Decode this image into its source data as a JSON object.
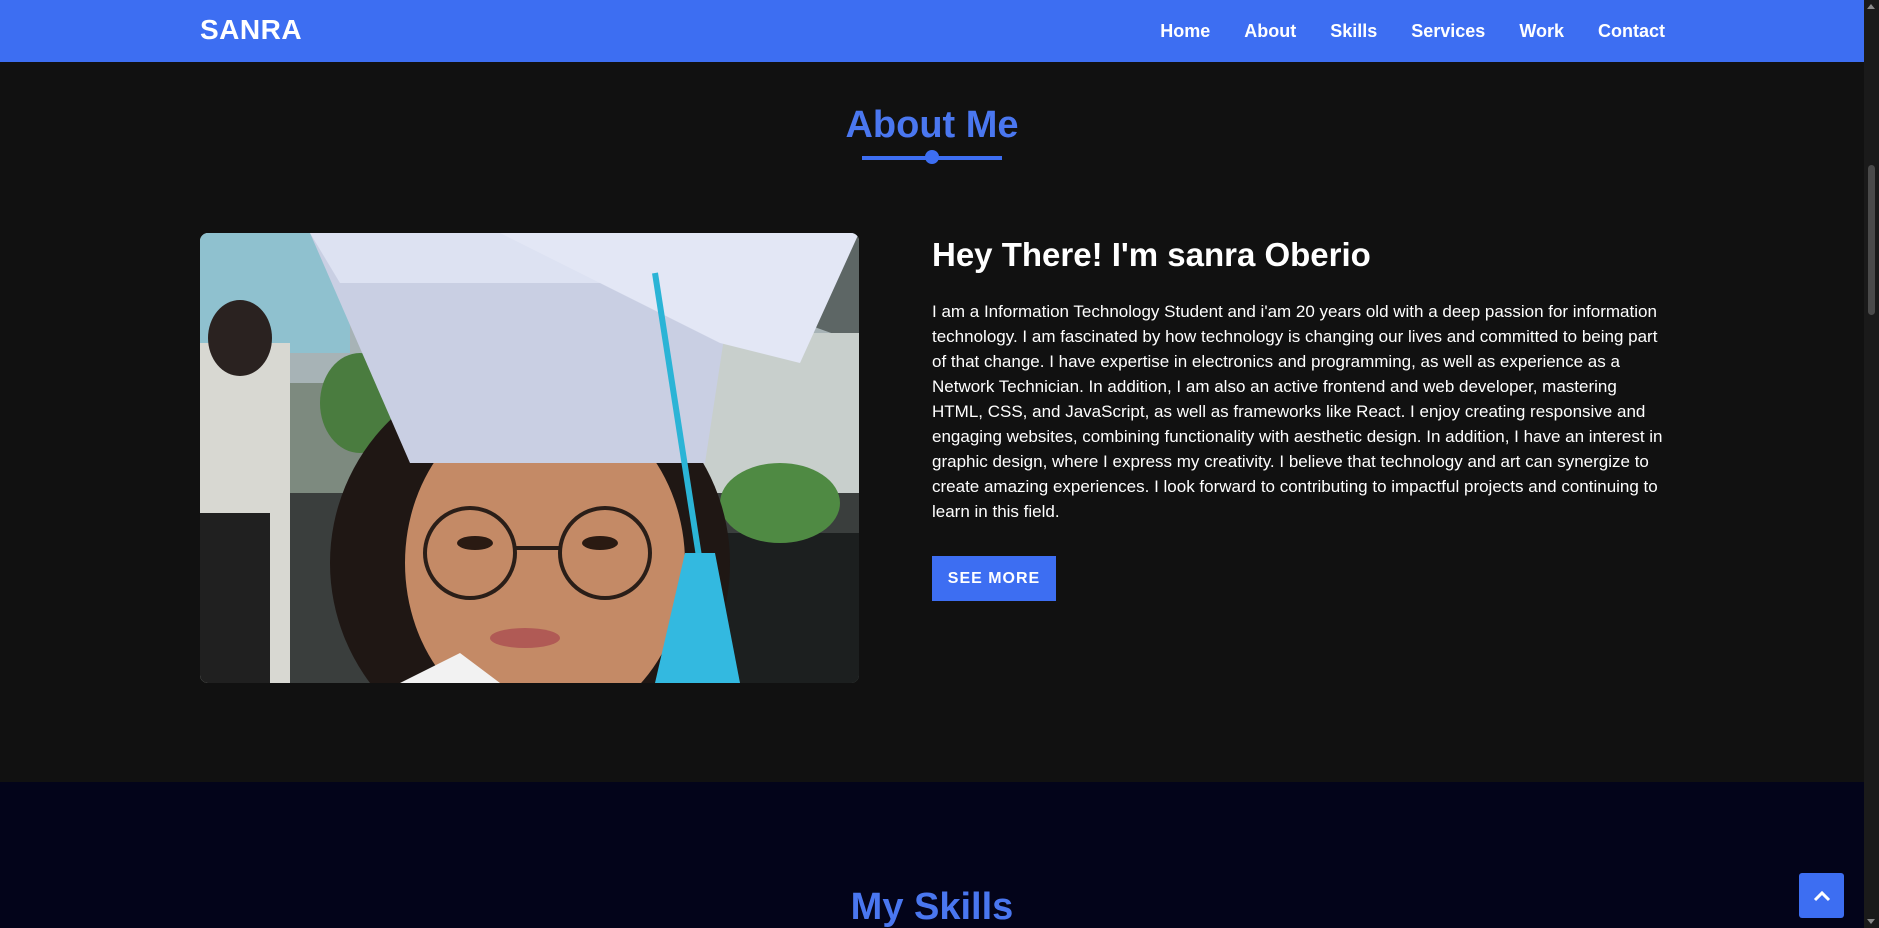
{
  "brand": "SANRA",
  "nav": {
    "items": [
      {
        "label": "Home"
      },
      {
        "label": "About"
      },
      {
        "label": "Skills"
      },
      {
        "label": "Services"
      },
      {
        "label": "Work"
      },
      {
        "label": "Contact"
      }
    ]
  },
  "about": {
    "title": "About Me",
    "heading": "Hey There! I'm sanra Oberio",
    "paragraph": "I am a Information Technology Student and i'am 20 years old with a deep passion for information technology. I am fascinated by how technology is changing our lives and committed to being part of that change. I have expertise in electronics and programming, as well as experience as a Network Technician. In addition, I am also an active frontend and web developer, mastering HTML, CSS, and JavaScript, as well as frameworks like React. I enjoy creating responsive and engaging websites, combining functionality with aesthetic design. In addition, I have an interest in graphic design, where I express my creativity. I believe that technology and art can synergize to create amazing experiences. I look forward to contributing to impactful projects and continuing to learn in this field.",
    "button_label": "SEE MORE"
  },
  "skills": {
    "title": "My Skills"
  },
  "icons": {
    "back_to_top": "chevron-up-icon"
  },
  "colors": {
    "accent": "#3d6ef2",
    "title": "#4a77f0",
    "about_bg": "#111111",
    "skills_bg": "#03041a"
  }
}
